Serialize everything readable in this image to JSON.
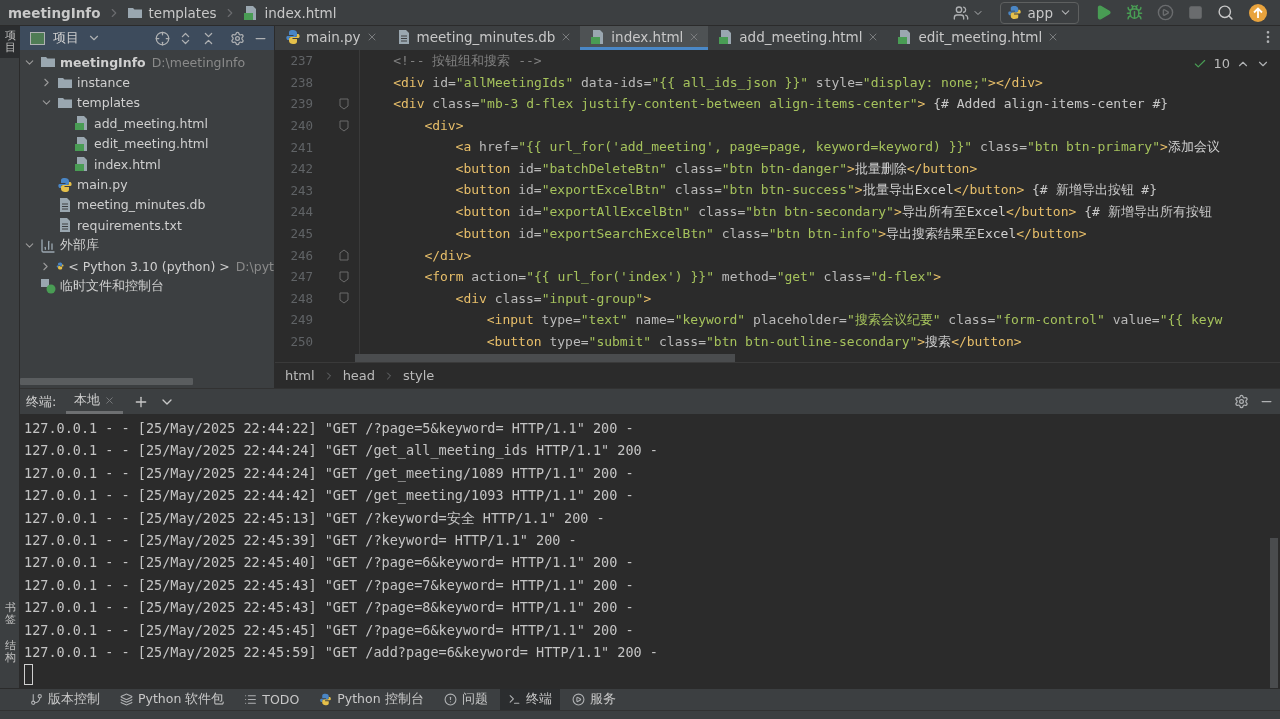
{
  "title_bar": {
    "breadcrumb": [
      {
        "label": "meetingInfo",
        "kind": "project"
      },
      {
        "label": "templates",
        "kind": "folder"
      },
      {
        "label": "index.html",
        "kind": "html"
      }
    ],
    "run_config": "app",
    "tools": [
      {
        "kind": "run",
        "disabled": false
      },
      {
        "kind": "debug",
        "disabled": false
      },
      {
        "kind": "coverage",
        "disabled": true
      },
      {
        "kind": "stop",
        "disabled": true
      }
    ]
  },
  "side_strip": {
    "top": [
      {
        "label": "项目",
        "selected": true
      }
    ],
    "bottom": [
      {
        "label": "书签",
        "selected": false
      },
      {
        "label": "结构",
        "selected": false
      }
    ]
  },
  "project_panel": {
    "title": "项目",
    "tree": [
      {
        "label": "meetingInfo",
        "kind": "project",
        "path": "D:\\meetingInfo",
        "expanded": true,
        "children": [
          {
            "label": "instance",
            "kind": "folder",
            "expanded": false
          },
          {
            "label": "templates",
            "kind": "folder",
            "expanded": true,
            "children": [
              {
                "label": "add_meeting.html",
                "kind": "html"
              },
              {
                "label": "edit_meeting.html",
                "kind": "html"
              },
              {
                "label": "index.html",
                "kind": "html"
              }
            ]
          },
          {
            "label": "main.py",
            "kind": "python"
          },
          {
            "label": "meeting_minutes.db",
            "kind": "file"
          },
          {
            "label": "requirements.txt",
            "kind": "file"
          }
        ]
      },
      {
        "label": "外部库",
        "kind": "library",
        "expanded": true,
        "children": [
          {
            "label": "< Python 3.10 (python) >",
            "kind": "sdk",
            "path": "D:\\pyt",
            "expanded": false
          }
        ]
      },
      {
        "label": "临时文件和控制台",
        "kind": "scratch"
      }
    ]
  },
  "editor": {
    "tabs": [
      {
        "label": "main.py",
        "kind": "python",
        "selected": false
      },
      {
        "label": "meeting_minutes.db",
        "kind": "file",
        "selected": false
      },
      {
        "label": "index.html",
        "kind": "html",
        "selected": true
      },
      {
        "label": "add_meeting.html",
        "kind": "html",
        "selected": false
      },
      {
        "label": "edit_meeting.html",
        "kind": "html",
        "selected": false
      }
    ],
    "inspection_count": "10",
    "lines": [
      {
        "number": "237",
        "tokens": [
          {
            "kind": "comment",
            "text": "<!-- 按钮组和搜索 -->"
          }
        ]
      },
      {
        "number": "238",
        "tokens": [
          {
            "kind": "tag",
            "text": "<div"
          },
          {
            "kind": "attr",
            "text": " id="
          },
          {
            "kind": "string",
            "text": "\"allMeetingIds\""
          },
          {
            "kind": "attr",
            "text": " data-ids="
          },
          {
            "kind": "string",
            "text": "\"{{ all_ids_json }}\""
          },
          {
            "kind": "attr",
            "text": " style="
          },
          {
            "kind": "string",
            "text": "\"display: none;\""
          },
          {
            "kind": "tag",
            "text": "></div>"
          }
        ]
      },
      {
        "number": "239",
        "fold_start": true,
        "tokens": [
          {
            "kind": "tag",
            "text": "<div"
          },
          {
            "kind": "attr",
            "text": " class="
          },
          {
            "kind": "string",
            "text": "\"mb-3 d-flex justify-content-between align-items-center\""
          },
          {
            "kind": "tag",
            "text": ">"
          },
          {
            "kind": "jinja",
            "text": " {# Added align-items-center #}"
          }
        ]
      },
      {
        "number": "240",
        "fold_start": true,
        "tokens": [
          {
            "kind": "tag",
            "text": "<div>"
          }
        ]
      },
      {
        "number": "241",
        "tokens": [
          {
            "kind": "tag",
            "text": "<a"
          },
          {
            "kind": "attr",
            "text": " href="
          },
          {
            "kind": "string",
            "text": "\"{{ url_for('add_meeting', page=page, keyword=keyword) }}\""
          },
          {
            "kind": "attr",
            "text": " class="
          },
          {
            "kind": "string",
            "text": "\"btn btn-primary\""
          },
          {
            "kind": "tag",
            "text": ">"
          },
          {
            "kind": "text",
            "text": "添加会议"
          }
        ]
      },
      {
        "number": "242",
        "tokens": [
          {
            "kind": "tag",
            "text": "<button"
          },
          {
            "kind": "attr",
            "text": " id="
          },
          {
            "kind": "string",
            "text": "\"batchDeleteBtn\""
          },
          {
            "kind": "attr",
            "text": " class="
          },
          {
            "kind": "string",
            "text": "\"btn btn-danger\""
          },
          {
            "kind": "tag",
            "text": ">"
          },
          {
            "kind": "text",
            "text": "批量删除"
          },
          {
            "kind": "tag",
            "text": "</button>"
          }
        ]
      },
      {
        "number": "243",
        "tokens": [
          {
            "kind": "tag",
            "text": "<button"
          },
          {
            "kind": "attr",
            "text": " id="
          },
          {
            "kind": "string",
            "text": "\"exportExcelBtn\""
          },
          {
            "kind": "attr",
            "text": " class="
          },
          {
            "kind": "string",
            "text": "\"btn btn-success\""
          },
          {
            "kind": "tag",
            "text": ">"
          },
          {
            "kind": "text",
            "text": "批量导出Excel"
          },
          {
            "kind": "tag",
            "text": "</button>"
          },
          {
            "kind": "jinja",
            "text": " {# 新增导出按钮 #}"
          }
        ]
      },
      {
        "number": "244",
        "tokens": [
          {
            "kind": "tag",
            "text": "<button"
          },
          {
            "kind": "attr",
            "text": " id="
          },
          {
            "kind": "string",
            "text": "\"exportAllExcelBtn\""
          },
          {
            "kind": "attr",
            "text": " class="
          },
          {
            "kind": "string",
            "text": "\"btn btn-secondary\""
          },
          {
            "kind": "tag",
            "text": ">"
          },
          {
            "kind": "text",
            "text": "导出所有至Excel"
          },
          {
            "kind": "tag",
            "text": "</button>"
          },
          {
            "kind": "jinja",
            "text": " {# 新增导出所有按钮"
          }
        ]
      },
      {
        "number": "245",
        "tokens": [
          {
            "kind": "tag",
            "text": "<button"
          },
          {
            "kind": "attr",
            "text": " id="
          },
          {
            "kind": "string",
            "text": "\"exportSearchExcelBtn\""
          },
          {
            "kind": "attr",
            "text": " class="
          },
          {
            "kind": "string",
            "text": "\"btn btn-info\""
          },
          {
            "kind": "tag",
            "text": ">"
          },
          {
            "kind": "text",
            "text": "导出搜索结果至Excel"
          },
          {
            "kind": "tag",
            "text": "</button>"
          }
        ]
      },
      {
        "number": "246",
        "fold_end": true,
        "tokens": [
          {
            "kind": "tag",
            "text": "</div>"
          }
        ]
      },
      {
        "number": "247",
        "fold_start": true,
        "tokens": [
          {
            "kind": "tag",
            "text": "<form"
          },
          {
            "kind": "attr",
            "text": " action="
          },
          {
            "kind": "string",
            "text": "\"{{ url_for('index') }}\""
          },
          {
            "kind": "attr",
            "text": " method="
          },
          {
            "kind": "string",
            "text": "\"get\""
          },
          {
            "kind": "attr",
            "text": " class="
          },
          {
            "kind": "string",
            "text": "\"d-flex\""
          },
          {
            "kind": "tag",
            "text": ">"
          }
        ]
      },
      {
        "number": "248",
        "fold_start": true,
        "tokens": [
          {
            "kind": "tag",
            "text": "<div"
          },
          {
            "kind": "attr",
            "text": " class="
          },
          {
            "kind": "string",
            "text": "\"input-group\""
          },
          {
            "kind": "tag",
            "text": ">"
          }
        ]
      },
      {
        "number": "249",
        "tokens": [
          {
            "kind": "tag",
            "text": "<input"
          },
          {
            "kind": "attr",
            "text": " type="
          },
          {
            "kind": "string",
            "text": "\"text\""
          },
          {
            "kind": "attr",
            "text": " name="
          },
          {
            "kind": "string",
            "text": "\"keyword\""
          },
          {
            "kind": "attr",
            "text": " placeholder="
          },
          {
            "kind": "string",
            "text": "\"搜索会议纪要\""
          },
          {
            "kind": "attr",
            "text": " class="
          },
          {
            "kind": "string",
            "text": "\"form-control\""
          },
          {
            "kind": "attr",
            "text": " value="
          },
          {
            "kind": "string",
            "text": "\"{{ keyw"
          }
        ]
      },
      {
        "number": "250",
        "tokens": [
          {
            "kind": "tag",
            "text": "<button"
          },
          {
            "kind": "attr",
            "text": " type="
          },
          {
            "kind": "string",
            "text": "\"submit\""
          },
          {
            "kind": "attr",
            "text": " class="
          },
          {
            "kind": "string",
            "text": "\"btn btn-outline-secondary\""
          },
          {
            "kind": "tag",
            "text": ">"
          },
          {
            "kind": "text",
            "text": "搜索"
          },
          {
            "kind": "tag",
            "text": "</button>"
          }
        ]
      }
    ],
    "breadcrumb": [
      "html",
      "head",
      "style"
    ]
  },
  "terminal": {
    "label": "终端:",
    "tabs": [
      {
        "label": "本地",
        "selected": true
      }
    ],
    "lines": [
      "127.0.0.1 - - [25/May/2025 22:44:22] \"GET /?page=5&keyword= HTTP/1.1\" 200 -",
      "127.0.0.1 - - [25/May/2025 22:44:24] \"GET /get_all_meeting_ids HTTP/1.1\" 200 -",
      "127.0.0.1 - - [25/May/2025 22:44:24] \"GET /get_meeting/1089 HTTP/1.1\" 200 -",
      "127.0.0.1 - - [25/May/2025 22:44:42] \"GET /get_meeting/1093 HTTP/1.1\" 200 -",
      "127.0.0.1 - - [25/May/2025 22:45:13] \"GET /?keyword=安全 HTTP/1.1\" 200 -",
      "127.0.0.1 - - [25/May/2025 22:45:39] \"GET /?keyword= HTTP/1.1\" 200 -",
      "127.0.0.1 - - [25/May/2025 22:45:40] \"GET /?page=6&keyword= HTTP/1.1\" 200 -",
      "127.0.0.1 - - [25/May/2025 22:45:43] \"GET /?page=7&keyword= HTTP/1.1\" 200 -",
      "127.0.0.1 - - [25/May/2025 22:45:43] \"GET /?page=8&keyword= HTTP/1.1\" 200 -",
      "127.0.0.1 - - [25/May/2025 22:45:45] \"GET /?page=6&keyword= HTTP/1.1\" 200 -",
      "127.0.0.1 - - [25/May/2025 22:45:59] \"GET /add?page=6&keyword= HTTP/1.1\" 200 -"
    ]
  },
  "tool_windows": [
    {
      "label": "版本控制",
      "kind": "vcs",
      "selected": false
    },
    {
      "label": "Python 软件包",
      "kind": "packages",
      "selected": false
    },
    {
      "label": "TODO",
      "kind": "todo",
      "selected": false
    },
    {
      "label": "Python 控制台",
      "kind": "python",
      "selected": false
    },
    {
      "label": "问题",
      "kind": "problems",
      "selected": false
    },
    {
      "label": "终端",
      "kind": "terminal",
      "selected": true
    },
    {
      "label": "服务",
      "kind": "services",
      "selected": false
    }
  ]
}
